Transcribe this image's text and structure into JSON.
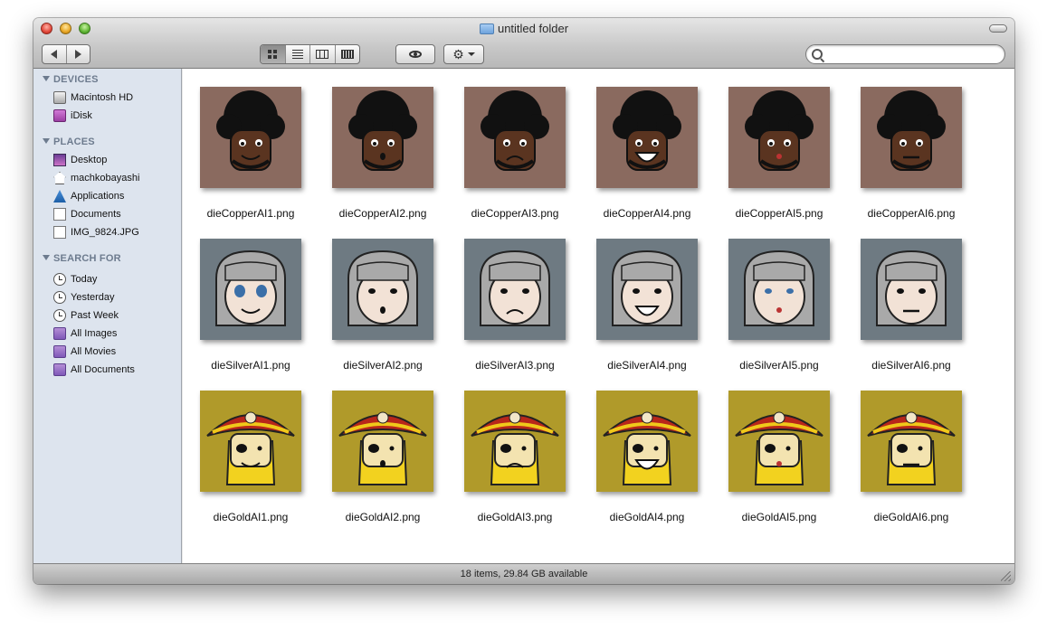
{
  "window": {
    "title": "untitled folder"
  },
  "toolbar": {
    "back_icon": "back-arrow-icon",
    "forward_icon": "forward-arrow-icon",
    "view_modes": [
      "icon-view",
      "list-view",
      "column-view",
      "cover-flow-view"
    ],
    "active_view": "icon-view",
    "quicklook_icon": "eye-icon",
    "action_icon": "gear-icon",
    "search": {
      "value": "",
      "placeholder": ""
    }
  },
  "sidebar": {
    "sections": [
      {
        "header": "DEVICES",
        "items": [
          {
            "label": "Macintosh HD",
            "icon": "hard-drive-icon"
          },
          {
            "label": "iDisk",
            "icon": "idisk-icon"
          }
        ]
      },
      {
        "header": "PLACES",
        "items": [
          {
            "label": "Desktop",
            "icon": "desktop-icon"
          },
          {
            "label": "machkobayashi",
            "icon": "home-icon"
          },
          {
            "label": "Applications",
            "icon": "applications-icon"
          },
          {
            "label": "Documents",
            "icon": "documents-icon"
          },
          {
            "label": "IMG_9824.JPG",
            "icon": "image-file-icon"
          }
        ]
      },
      {
        "header": "SEARCH FOR",
        "items": [
          {
            "label": "Today",
            "icon": "clock-icon"
          },
          {
            "label": "Yesterday",
            "icon": "clock-icon"
          },
          {
            "label": "Past Week",
            "icon": "clock-icon"
          },
          {
            "label": "All Images",
            "icon": "smart-folder-icon"
          },
          {
            "label": "All Movies",
            "icon": "smart-folder-icon"
          },
          {
            "label": "All Documents",
            "icon": "smart-folder-icon"
          }
        ]
      }
    ]
  },
  "files": [
    {
      "name": "dieCopperAI1.png"
    },
    {
      "name": "dieCopperAI2.png"
    },
    {
      "name": "dieCopperAI3.png"
    },
    {
      "name": "dieCopperAI4.png"
    },
    {
      "name": "dieCopperAI5.png"
    },
    {
      "name": "dieCopperAI6.png"
    },
    {
      "name": "dieSilverAI1.png"
    },
    {
      "name": "dieSilverAI2.png"
    },
    {
      "name": "dieSilverAI3.png"
    },
    {
      "name": "dieSilverAI4.png"
    },
    {
      "name": "dieSilverAI5.png"
    },
    {
      "name": "dieSilverAI6.png"
    },
    {
      "name": "dieGoldAI1.png"
    },
    {
      "name": "dieGoldAI2.png"
    },
    {
      "name": "dieGoldAI3.png"
    },
    {
      "name": "dieGoldAI4.png"
    },
    {
      "name": "dieGoldAI5.png"
    },
    {
      "name": "dieGoldAI6.png"
    }
  ],
  "status": {
    "text": "18 items, 29.84 GB available"
  },
  "colors": {
    "copper_bg": "#8a6a5f",
    "copper_skin": "#5a3420",
    "hair": "#111111",
    "silver_bg": "#6e7a82",
    "silver_skin": "#f2e2d6",
    "silver_hair": "#a9a9a9",
    "gold_bg": "#b09a2a",
    "gold_beard": "#f2d21f",
    "hat_red": "#b8261b",
    "hat_yellow": "#f0c81a"
  }
}
